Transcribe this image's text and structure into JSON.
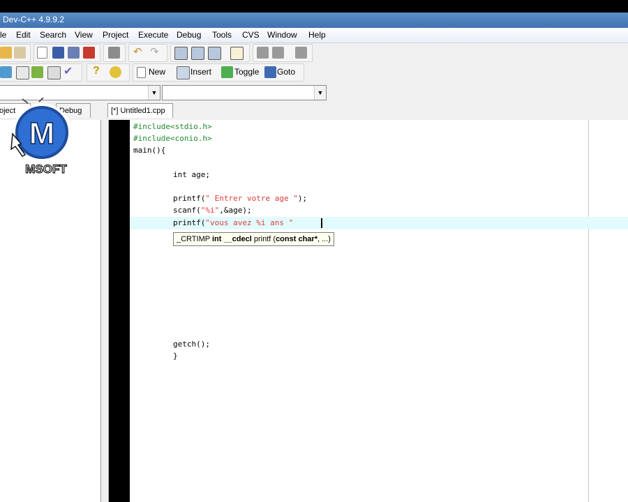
{
  "window": {
    "title": "Dev-C++ 4.9.9.2"
  },
  "menu": [
    "le",
    "Edit",
    "Search",
    "View",
    "Project",
    "Execute",
    "Debug",
    "Tools",
    "CVS",
    "Window",
    "Help"
  ],
  "toolbar": {
    "new_label": "New",
    "insert_label": "Insert",
    "toggle_label": "Toggle",
    "goto_label": "Goto"
  },
  "panel_tabs": {
    "project": "oject",
    "debug": "Debug"
  },
  "editor_tab": "[*] Untitled1.cpp",
  "logo_text": "MSOFT",
  "logo_letter": "M",
  "code": {
    "l1": "#include<stdio.h>",
    "l2": "#include<conio.h>",
    "l3": "main(){",
    "l4": "int age;",
    "l5a": "printf(",
    "l5b": "\" Entrer votre age \"",
    "l5c": ");",
    "l6a": "scanf(",
    "l6b": "\"%i\"",
    "l6c": ",&age);",
    "l7a": "printf(",
    "l7b": "\"vous avez %i ans \"",
    "l8": "getch();",
    "l9": "}"
  },
  "tooltip": {
    "part1": "_CRTIMP ",
    "part2": "int __cdecl ",
    "part3": "printf (",
    "part4": "const char*",
    "part5": ", ...)"
  },
  "colors": {
    "titlebar": "#3f72b2",
    "preprocessor": "#1f8a2f",
    "string": "#e03a3a",
    "line_highlight": "#e2fbfd"
  }
}
